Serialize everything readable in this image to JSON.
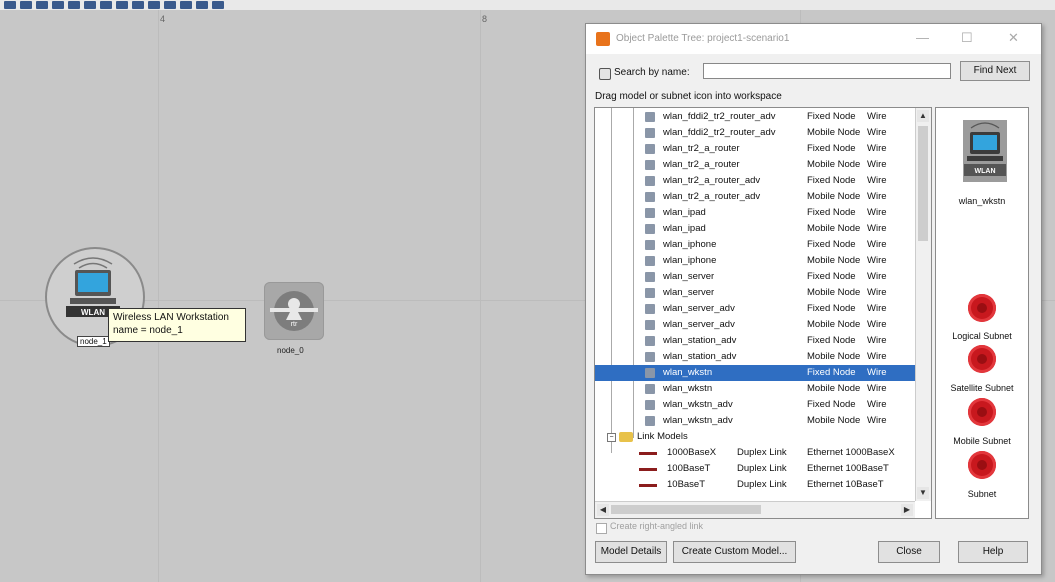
{
  "dialog": {
    "title": "Object Palette Tree: project1-scenario1",
    "search_label": "Search by name:",
    "search_value": "",
    "find_next": "Find Next",
    "hint": "Drag model or subnet icon into workspace",
    "rows": [
      {
        "name": "wlan_fddi2_tr2_router_adv",
        "type": "Fixed Node",
        "tech": "Wire"
      },
      {
        "name": "wlan_fddi2_tr2_router_adv",
        "type": "Mobile Node",
        "tech": "Wire"
      },
      {
        "name": "wlan_tr2_a_router",
        "type": "Fixed Node",
        "tech": "Wire"
      },
      {
        "name": "wlan_tr2_a_router",
        "type": "Mobile Node",
        "tech": "Wire"
      },
      {
        "name": "wlan_tr2_a_router_adv",
        "type": "Fixed Node",
        "tech": "Wire"
      },
      {
        "name": "wlan_tr2_a_router_adv",
        "type": "Mobile Node",
        "tech": "Wire"
      },
      {
        "name": "wlan_ipad",
        "type": "Fixed Node",
        "tech": "Wire"
      },
      {
        "name": "wlan_ipad",
        "type": "Mobile Node",
        "tech": "Wire"
      },
      {
        "name": "wlan_iphone",
        "type": "Fixed Node",
        "tech": "Wire"
      },
      {
        "name": "wlan_iphone",
        "type": "Mobile Node",
        "tech": "Wire"
      },
      {
        "name": "wlan_server",
        "type": "Fixed Node",
        "tech": "Wire"
      },
      {
        "name": "wlan_server",
        "type": "Mobile Node",
        "tech": "Wire"
      },
      {
        "name": "wlan_server_adv",
        "type": "Fixed Node",
        "tech": "Wire"
      },
      {
        "name": "wlan_server_adv",
        "type": "Mobile Node",
        "tech": "Wire"
      },
      {
        "name": "wlan_station_adv",
        "type": "Fixed Node",
        "tech": "Wire"
      },
      {
        "name": "wlan_station_adv",
        "type": "Mobile Node",
        "tech": "Wire"
      },
      {
        "name": "wlan_wkstn",
        "type": "Fixed Node",
        "tech": "Wire"
      },
      {
        "name": "wlan_wkstn",
        "type": "Mobile Node",
        "tech": "Wire"
      },
      {
        "name": "wlan_wkstn_adv",
        "type": "Fixed Node",
        "tech": "Wire"
      },
      {
        "name": "wlan_wkstn_adv",
        "type": "Mobile Node",
        "tech": "Wire"
      }
    ],
    "link_folder": "Link Models",
    "links": [
      {
        "name": "1000BaseX",
        "type": "Duplex Link",
        "tech": "Ethernet 1000BaseX"
      },
      {
        "name": "100BaseT",
        "type": "Duplex Link",
        "tech": "Ethernet 100BaseT"
      },
      {
        "name": "10BaseT",
        "type": "Duplex Link",
        "tech": "Ethernet 10BaseT"
      }
    ],
    "preview_badge": "WLAN",
    "preview_label": "wlan_wkstn",
    "subnets": [
      "Logical Subnet",
      "Satellite Subnet",
      "Mobile Subnet",
      "Subnet"
    ],
    "checkbox_label": "Create right-angled link",
    "buttons": {
      "model_details": "Model Details",
      "create_custom": "Create Custom Model...",
      "close": "Close",
      "help": "Help"
    }
  },
  "workspace": {
    "ruler_marks": [
      "4",
      "8"
    ],
    "node1_badge": "WLAN",
    "node1_label": "node_1",
    "tooltip_line1": "Wireless LAN Workstation",
    "tooltip_line2": "name = node_1",
    "node2_label": "node_0",
    "node2_badge": "rtr"
  },
  "colors": {
    "selection": "#2f6ec2",
    "subnet_red": "#c8181e",
    "tooltip_bg": "#ffffe1",
    "workspace_bg": "#c7c7c7"
  }
}
